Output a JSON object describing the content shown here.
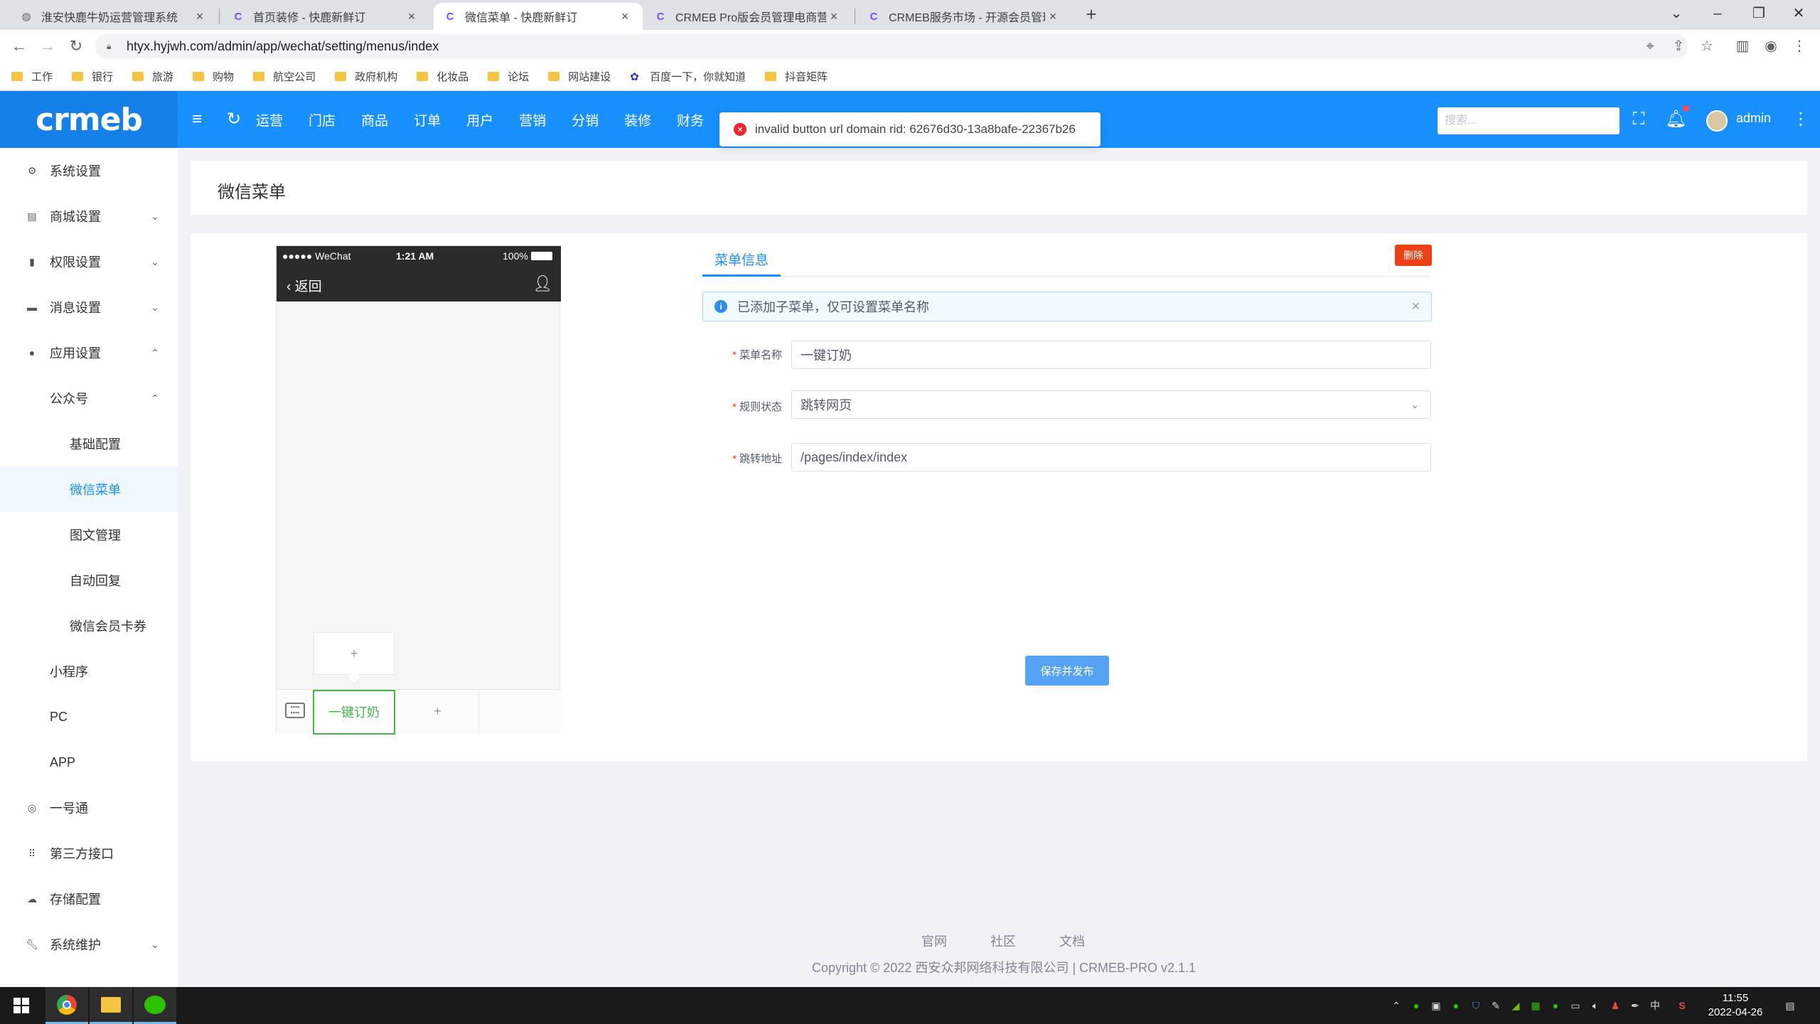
{
  "browser": {
    "tabs": [
      {
        "title": "淮安快鹿牛奶运营管理系统"
      },
      {
        "title": "首页装修 - 快鹿新鲜订"
      },
      {
        "title": "微信菜单 - 快鹿新鲜订"
      },
      {
        "title": "CRMEB Pro版会员管理电商营销"
      },
      {
        "title": "CRMEB服务市场 - 开源会员管理"
      }
    ],
    "url": "htyx.hyjwh.com/admin/app/wechat/setting/menus/index",
    "bookmarks": [
      "工作",
      "银行",
      "旅游",
      "购物",
      "航空公司",
      "政府机构",
      "化妆品",
      "论坛",
      "网站建设",
      "百度一下，你就知道",
      "抖音矩阵"
    ]
  },
  "header": {
    "logo": "crmeb",
    "nav": [
      "运营",
      "门店",
      "商品",
      "订单",
      "用户",
      "营销",
      "分销",
      "装修",
      "财务"
    ],
    "search_placeholder": "搜索...",
    "username": "admin"
  },
  "toast": {
    "message": "invalid button url domain rid: 62676d30-13a8bafe-22367b26"
  },
  "sidebar": {
    "items": [
      {
        "label": "系统设置"
      },
      {
        "label": "商城设置"
      },
      {
        "label": "权限设置"
      },
      {
        "label": "消息设置"
      },
      {
        "label": "应用设置"
      },
      {
        "label": "公众号"
      },
      {
        "label": "基础配置"
      },
      {
        "label": "微信菜单"
      },
      {
        "label": "图文管理"
      },
      {
        "label": "自动回复"
      },
      {
        "label": "微信会员卡券"
      },
      {
        "label": "小程序"
      },
      {
        "label": "PC"
      },
      {
        "label": "APP"
      },
      {
        "label": "一号通"
      },
      {
        "label": "第三方接口"
      },
      {
        "label": "存储配置"
      },
      {
        "label": "系统维护"
      }
    ]
  },
  "page": {
    "title": "微信菜单"
  },
  "phone": {
    "carrier": "●●●●● WeChat",
    "time": "1:21 AM",
    "battery": "100%",
    "back": "返回",
    "submenu_add": "+",
    "menu_button": "一键订奶",
    "menu_add": "+"
  },
  "form": {
    "tab": "菜单信息",
    "delete": "删除",
    "alert": "已添加子菜单，仅可设置菜单名称",
    "name_label": "菜单名称",
    "name_value": "一键订奶",
    "rule_label": "规则状态",
    "rule_value": "跳转网页",
    "url_label": "跳转地址",
    "url_value": "/pages/index/index",
    "save": "保存并发布"
  },
  "footer": {
    "links": [
      "官网",
      "社区",
      "文档"
    ],
    "copyright": "Copyright © 2022 西安众邦网络科技有限公司 | CRMEB-PRO v2.1.1"
  },
  "taskbar": {
    "time": "11:55",
    "date": "2022-04-26",
    "ime": "中"
  }
}
